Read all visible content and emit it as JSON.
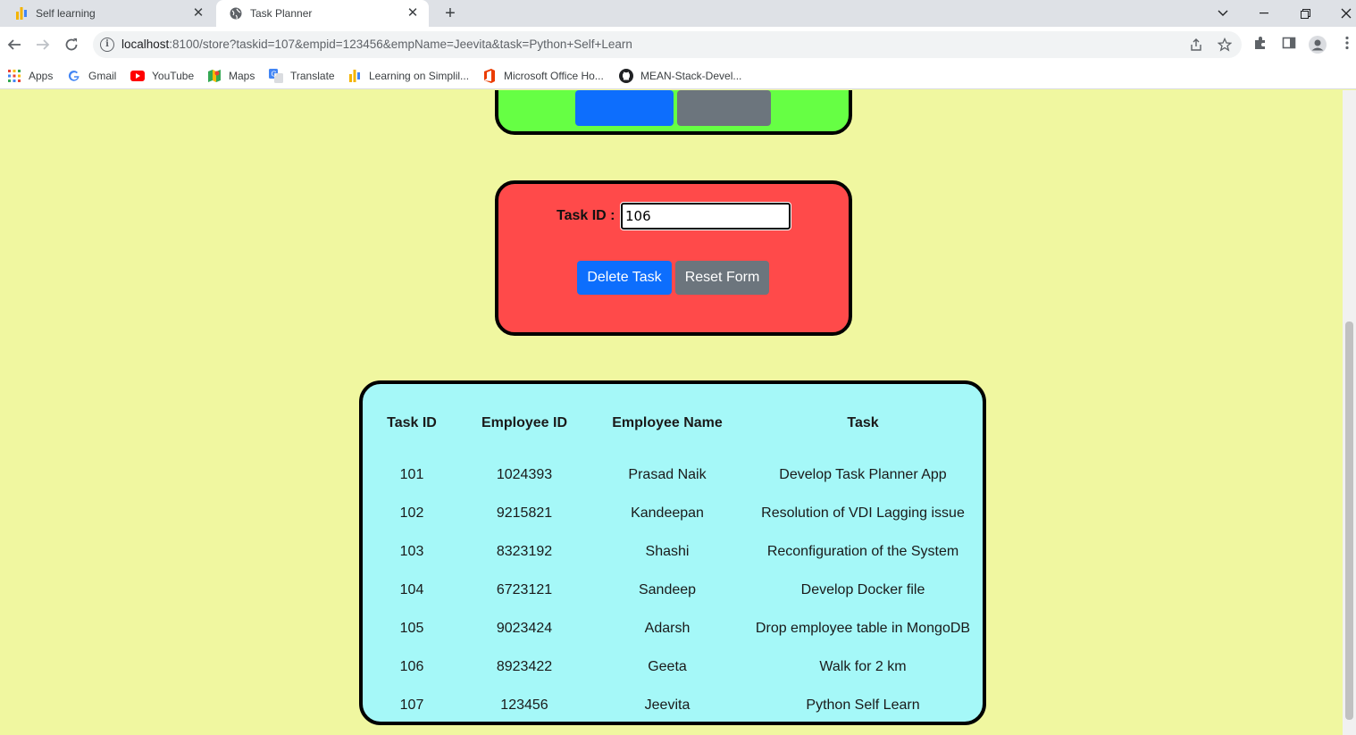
{
  "browser": {
    "tabs": [
      {
        "title": "Self learning",
        "active": false
      },
      {
        "title": "Task Planner",
        "active": true
      }
    ],
    "url": {
      "host": "localhost",
      "rest": ":8100/store?taskid=107&empid=123456&empName=Jeevita&task=Python+Self+Learn"
    },
    "bookmarks": [
      {
        "label": "Apps",
        "icon": "apps-grid-icon"
      },
      {
        "label": "Gmail",
        "icon": "google-icon"
      },
      {
        "label": "YouTube",
        "icon": "youtube-icon"
      },
      {
        "label": "Maps",
        "icon": "maps-icon"
      },
      {
        "label": "Translate",
        "icon": "translate-icon"
      },
      {
        "label": "Learning on Simplil...",
        "icon": "simplilearn-icon"
      },
      {
        "label": "Microsoft Office Ho...",
        "icon": "office-icon"
      },
      {
        "label": "MEAN-Stack-Devel...",
        "icon": "github-icon"
      }
    ]
  },
  "delete_form": {
    "task_id_label": "Task ID :",
    "task_id_value": "106",
    "delete_button": "Delete Task",
    "reset_button": "Reset Form"
  },
  "table": {
    "headers": [
      "Task ID",
      "Employee ID",
      "Employee Name",
      "Task"
    ],
    "rows": [
      [
        "101",
        "1024393",
        "Prasad Naik",
        "Develop Task Planner App"
      ],
      [
        "102",
        "9215821",
        "Kandeepan",
        "Resolution of VDI Lagging issue"
      ],
      [
        "103",
        "8323192",
        "Shashi",
        "Reconfiguration of the System"
      ],
      [
        "104",
        "6723121",
        "Sandeep",
        "Develop Docker file"
      ],
      [
        "105",
        "9023424",
        "Adarsh",
        "Drop employee table in MongoDB"
      ],
      [
        "106",
        "8923422",
        "Geeta",
        "Walk for 2 km"
      ],
      [
        "107",
        "123456",
        "Jeevita",
        "Python Self Learn"
      ]
    ]
  },
  "colors": {
    "page_bg": "#f0f7a0",
    "green_card": "#66ff44",
    "red_card": "#ff4a4a",
    "cyan_card": "#a5f8f8",
    "primary_button": "#0d6efd",
    "secondary_button": "#6c757d"
  }
}
